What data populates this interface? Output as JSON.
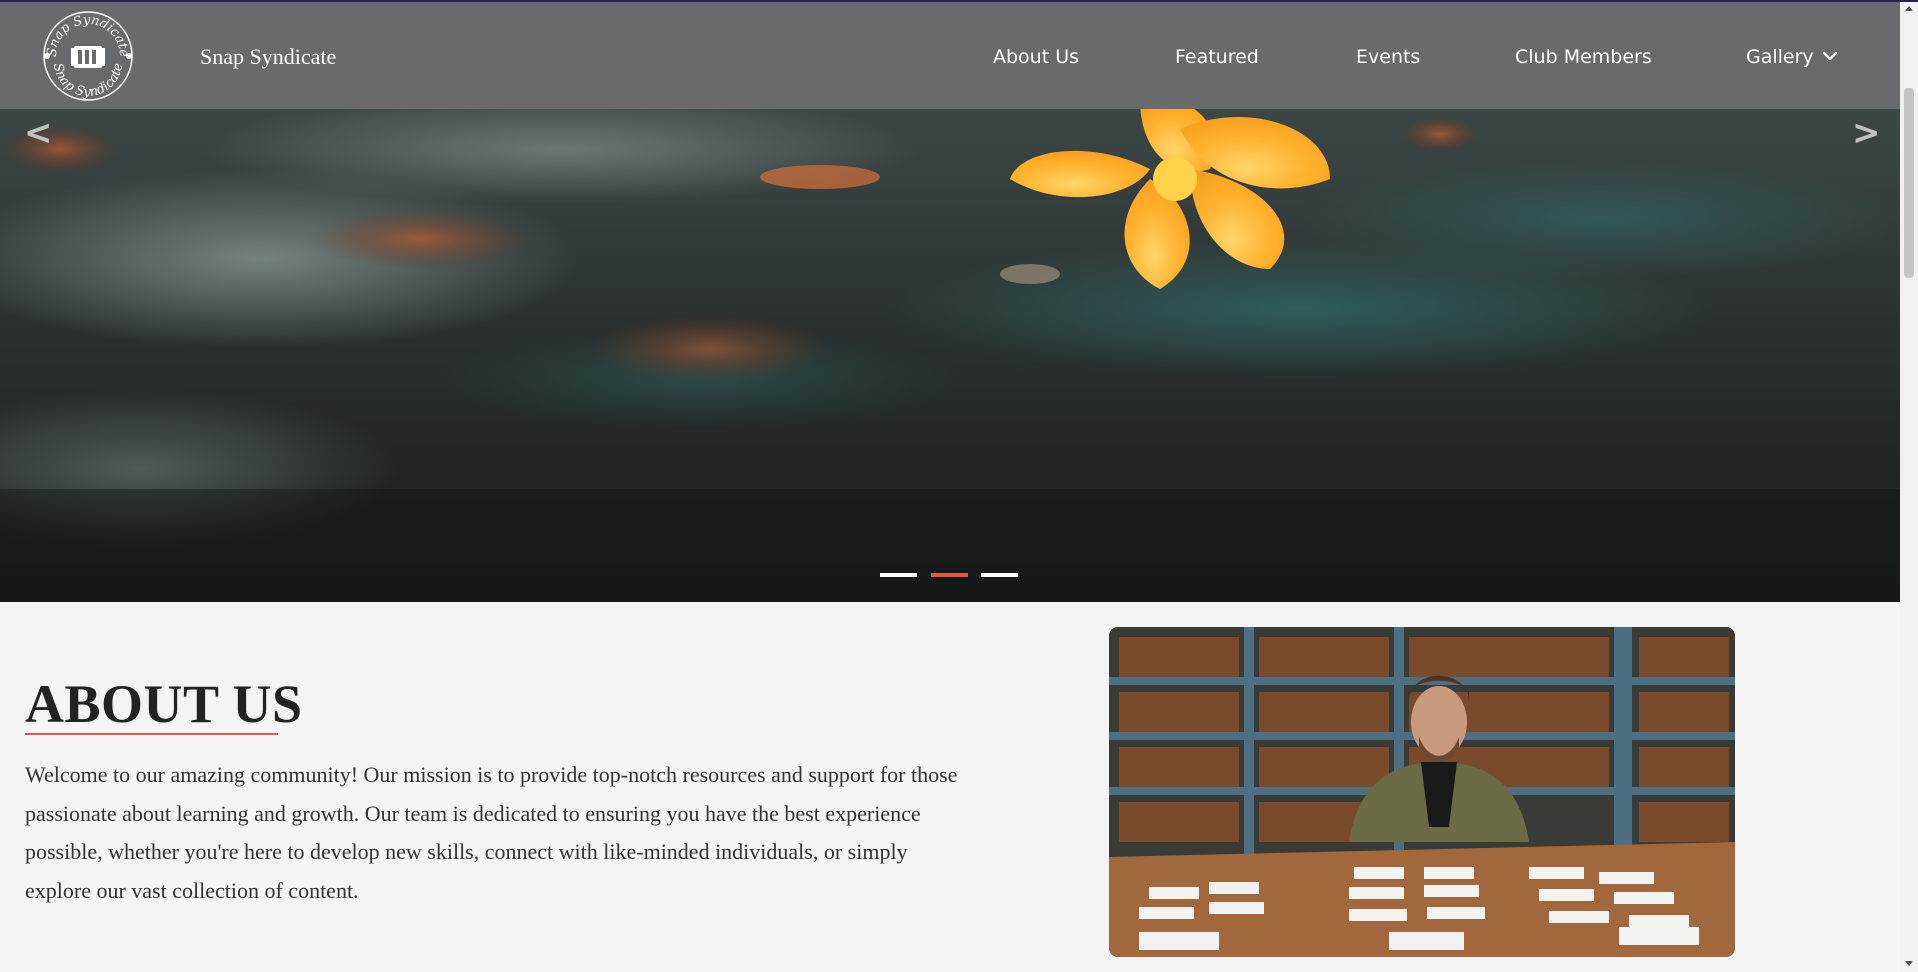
{
  "header": {
    "logo_ring_text": "Snap Syndicate",
    "brand": "Snap Syndicate",
    "nav": [
      {
        "label": "About Us"
      },
      {
        "label": "Featured"
      },
      {
        "label": "Events"
      },
      {
        "label": "Club Members"
      },
      {
        "label": "Gallery",
        "icon": "chevron-down-icon"
      }
    ]
  },
  "carousel": {
    "prev_label": "<",
    "next_label": ">",
    "slide_count": 3,
    "active_index": 1,
    "image": "orange-flower-on-ground",
    "indicator_active_color": "#e2574c"
  },
  "about": {
    "title": "ABOUT US",
    "text": "Welcome to our amazing community! Our mission is to provide top-notch resources and support for those passionate about learning and growth. Our team is dedicated to ensuring you have the best experience possible, whether you're here to develop new skills, connect with like-minded individuals, or simply explore our vast collection of content.",
    "image": "man-at-table-with-cards-in-library"
  },
  "colors": {
    "navbar": "#686a6e",
    "accent": "#e2574c",
    "background": "#f4f4f4"
  }
}
